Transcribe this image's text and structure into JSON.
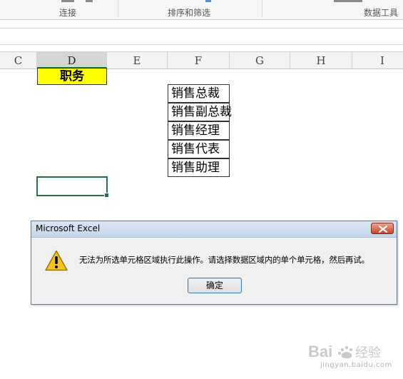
{
  "ribbon": {
    "groups": [
      "连接",
      "排序和筛选",
      "数据工具"
    ]
  },
  "columns": [
    "C",
    "D",
    "E",
    "F",
    "G",
    "H",
    "I"
  ],
  "selected_column": "D",
  "cells": {
    "header": "职务",
    "list": [
      "销售总裁",
      "销售副总裁",
      "销售经理",
      "销售代表",
      "销售助理"
    ]
  },
  "dialog": {
    "title": "Microsoft Excel",
    "message": "无法为所选单元格区域执行此操作。请选择数据区域内的单个单元格，然后再试。",
    "ok_label": "确定",
    "icon": "warning-icon",
    "close_icon": "close-icon"
  },
  "colors": {
    "header_fill": "#ffff00",
    "selection": "#217346"
  },
  "watermark": {
    "url": "jingyan.baidu.com"
  }
}
